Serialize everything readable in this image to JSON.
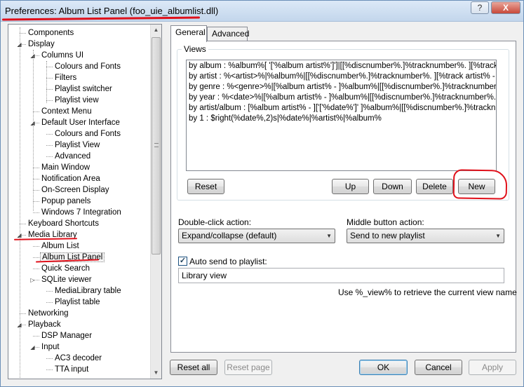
{
  "window": {
    "title": "Preferences: Album List Panel (foo_uie_albumlist.dll)",
    "help_label": "?",
    "close_label": "X"
  },
  "tree": {
    "expand_collapsed": "▷",
    "expand_open": "◢",
    "items": [
      {
        "label": "Components",
        "level": 0,
        "expander": "none"
      },
      {
        "label": "Display",
        "level": 0,
        "expander": "open"
      },
      {
        "label": "Columns UI",
        "level": 1,
        "expander": "open"
      },
      {
        "label": "Colours and Fonts",
        "level": 2,
        "expander": "none"
      },
      {
        "label": "Filters",
        "level": 2,
        "expander": "none"
      },
      {
        "label": "Playlist switcher",
        "level": 2,
        "expander": "none"
      },
      {
        "label": "Playlist view",
        "level": 2,
        "expander": "none"
      },
      {
        "label": "Context Menu",
        "level": 1,
        "expander": "none"
      },
      {
        "label": "Default User Interface",
        "level": 1,
        "expander": "open"
      },
      {
        "label": "Colours and Fonts",
        "level": 2,
        "expander": "none"
      },
      {
        "label": "Playlist View",
        "level": 2,
        "expander": "none"
      },
      {
        "label": "Advanced",
        "level": 2,
        "expander": "none"
      },
      {
        "label": "Main Window",
        "level": 1,
        "expander": "none"
      },
      {
        "label": "Notification Area",
        "level": 1,
        "expander": "none"
      },
      {
        "label": "On-Screen Display",
        "level": 1,
        "expander": "none"
      },
      {
        "label": "Popup panels",
        "level": 1,
        "expander": "none"
      },
      {
        "label": "Windows 7 Integration",
        "level": 1,
        "expander": "none"
      },
      {
        "label": "Keyboard Shortcuts",
        "level": 0,
        "expander": "none"
      },
      {
        "label": "Media Library",
        "level": 0,
        "expander": "open"
      },
      {
        "label": "Album List",
        "level": 1,
        "expander": "none"
      },
      {
        "label": "Album List Panel",
        "level": 1,
        "expander": "none",
        "selected": true
      },
      {
        "label": "Quick Search",
        "level": 1,
        "expander": "none"
      },
      {
        "label": "SQLite viewer",
        "level": 1,
        "expander": "collapsed"
      },
      {
        "label": "MediaLibrary table",
        "level": 2,
        "expander": "none"
      },
      {
        "label": "Playlist table",
        "level": 2,
        "expander": "none"
      },
      {
        "label": "Networking",
        "level": 0,
        "expander": "none"
      },
      {
        "label": "Playback",
        "level": 0,
        "expander": "open"
      },
      {
        "label": "DSP Manager",
        "level": 1,
        "expander": "none"
      },
      {
        "label": "Input",
        "level": 1,
        "expander": "open"
      },
      {
        "label": "AC3 decoder",
        "level": 2,
        "expander": "none"
      },
      {
        "label": "TTA input",
        "level": 2,
        "expander": "none"
      }
    ],
    "scroll_up": "▲",
    "scroll_down": "▼"
  },
  "tabs": [
    {
      "label": "General",
      "active": true
    },
    {
      "label": "Advanced",
      "active": false
    }
  ],
  "views": {
    "group_title": "Views",
    "rows": [
      "by album : %album%[ '['%album artist%']']|[[%discnumber%.]%tracknumber%. ][%track artist% - ]%title%",
      "by artist : %<artist>%|%album%|[[%discnumber%.]%tracknumber%. ][%track artist% - ]%title%",
      "by genre : %<genre>%|[%album artist% - ]%album%|[[%discnumber%.]%tracknumber%. ][%track artist% - ]%title%",
      "by year : %<date>%|[%album artist% - ]%album%|[[%discnumber%.]%tracknumber%. ][%track artist% - ]%title%",
      "by artist/album : [%album artist% - ]['['%date%']' ]%album%|[[%discnumber%.]%tracknumber%. ][%track artist% - ]%title%",
      "by 1 : $right(%date%,2)s|%date%|%artist%|%album%"
    ],
    "reset_label": "Reset",
    "up_label": "Up",
    "down_label": "Down",
    "delete_label": "Delete",
    "new_label": "New"
  },
  "double_click": {
    "label": "Double-click action:",
    "value": "Expand/collapse (default)"
  },
  "middle_button": {
    "label": "Middle button action:",
    "value": "Send to new playlist"
  },
  "auto_send": {
    "label": "Auto send to playlist:",
    "checked": true,
    "check_glyph": "✓",
    "value": "Library view",
    "hint": "Use %_view% to retrieve the current view name"
  },
  "footer": {
    "reset_all_label": "Reset all",
    "reset_page_label": "Reset page",
    "ok_label": "OK",
    "cancel_label": "Cancel",
    "apply_label": "Apply"
  },
  "colors": {
    "annotation": "#e0101a",
    "default_button_border": "#3c7fb1"
  },
  "icons": {
    "dropdown": "chevron-down-icon",
    "checkbox": "check-icon"
  }
}
